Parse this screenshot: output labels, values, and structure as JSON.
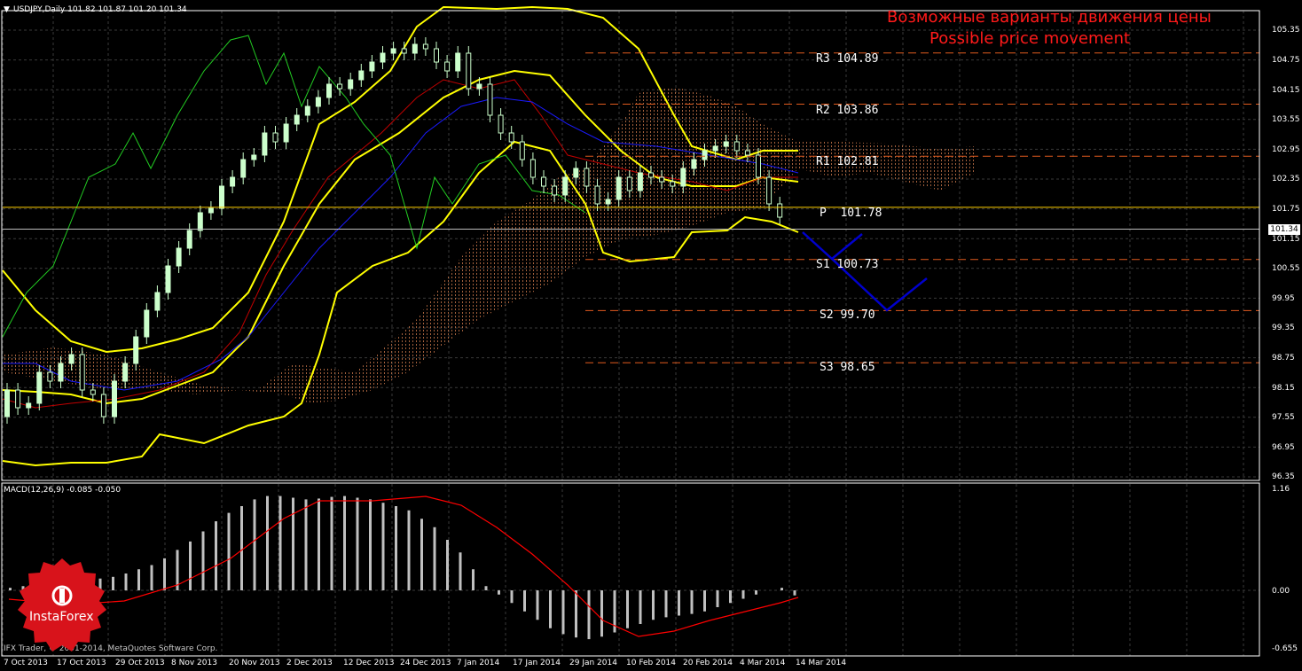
{
  "header": {
    "icon": "triangle-down-icon",
    "symbol_info": "USDJPY,Daily  101.82 101.87 101.20 101.34",
    "title_ru": "Возможные варианты движения цены",
    "title_en": "Possible price movement"
  },
  "levels": [
    {
      "label": "R3 104.89",
      "value": 104.89
    },
    {
      "label": "R2 103.86",
      "value": 103.86
    },
    {
      "label": "R1 102.81",
      "value": 102.81
    },
    {
      "label": "P  101.78",
      "value": 101.78
    },
    {
      "label": "S1 100.73",
      "value": 100.73
    },
    {
      "label": "S2 99.70",
      "value": 99.7
    },
    {
      "label": "S3 98.65",
      "value": 98.65
    }
  ],
  "current_price": "101.34",
  "price_axis": [
    "105.35",
    "104.75",
    "104.15",
    "103.55",
    "102.95",
    "102.35",
    "101.75",
    "101.15",
    "100.55",
    "99.95",
    "99.35",
    "98.75",
    "98.15",
    "97.55",
    "96.95",
    "96.35"
  ],
  "macd": {
    "label": "MACD(12,26,9) -0.085 -0.050",
    "axis": [
      "1.16",
      "0.00",
      "-0.655"
    ]
  },
  "date_axis": [
    "7 Oct 2013",
    "17 Oct 2013",
    "29 Oct 2013",
    "8 Nov 2013",
    "20 Nov 2013",
    "2 Dec 2013",
    "12 Dec 2013",
    "24 Dec 2013",
    "7 Jan 2014",
    "17 Jan 2014",
    "29 Jan 2014",
    "10 Feb 2014",
    "20 Feb 2014",
    "4 Mar 2014",
    "14 Mar 2014"
  ],
  "copyright": "IFX Trader, © 2001-2014, MetaQuotes Software Corp.",
  "logo": {
    "text": "InstaForex",
    "icon": "instaforex-logo-icon"
  },
  "colors": {
    "background": "#000000",
    "grid": "#3a3a3a",
    "bollinger": "#ffff00",
    "macd_signal": "#ff0000",
    "macd_hist": "#c0c0c0",
    "level_line": "#e05a1e",
    "pivot_line": "#ffd000",
    "forecast": "#0000cc",
    "title": "#ff1a1a"
  }
}
